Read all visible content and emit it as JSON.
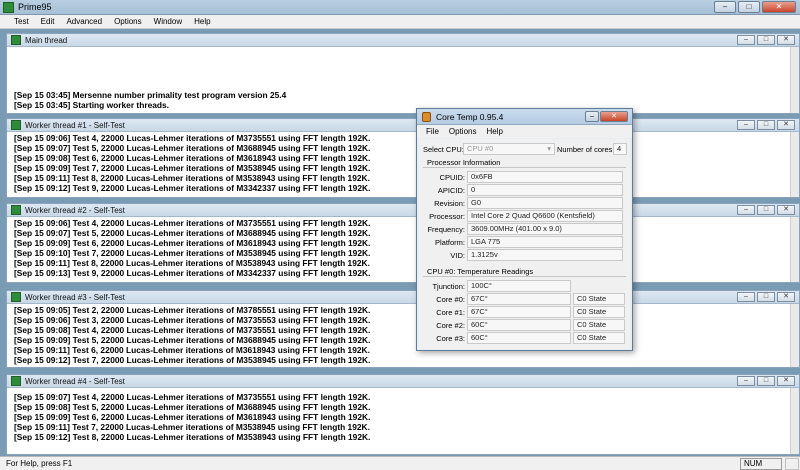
{
  "app": {
    "title": "Prime95"
  },
  "window_buttons": {
    "minimize": "–",
    "maximize": "□",
    "close": "✕"
  },
  "menu": [
    "Test",
    "Edit",
    "Advanced",
    "Options",
    "Window",
    "Help"
  ],
  "main_thread": {
    "title": "Main thread",
    "lines": [
      "[Sep 15 03:45] Mersenne number primality test program version 25.4",
      "[Sep 15 03:45] Starting worker threads."
    ]
  },
  "worker1": {
    "title": "Worker thread #1 - Self-Test",
    "lines": [
      "[Sep 15 09:06] Test 4, 22000 Lucas-Lehmer iterations of M3735551 using FFT length 192K.",
      "[Sep 15 09:07] Test 5, 22000 Lucas-Lehmer iterations of M3688945 using FFT length 192K.",
      "[Sep 15 09:08] Test 6, 22000 Lucas-Lehmer iterations of M3618943 using FFT length 192K.",
      "[Sep 15 09:09] Test 7, 22000 Lucas-Lehmer iterations of M3538945 using FFT length 192K.",
      "[Sep 15 09:11] Test 8, 22000 Lucas-Lehmer iterations of M3538943 using FFT length 192K.",
      "[Sep 15 09:12] Test 9, 22000 Lucas-Lehmer iterations of M3342337 using FFT length 192K."
    ]
  },
  "worker2": {
    "title": "Worker thread #2 - Self-Test",
    "lines": [
      "[Sep 15 09:06] Test 4, 22000 Lucas-Lehmer iterations of M3735551 using FFT length 192K.",
      "[Sep 15 09:07] Test 5, 22000 Lucas-Lehmer iterations of M3688945 using FFT length 192K.",
      "[Sep 15 09:09] Test 6, 22000 Lucas-Lehmer iterations of M3618943 using FFT length 192K.",
      "[Sep 15 09:10] Test 7, 22000 Lucas-Lehmer iterations of M3538945 using FFT length 192K.",
      "[Sep 15 09:11] Test 8, 22000 Lucas-Lehmer iterations of M3538943 using FFT length 192K.",
      "[Sep 15 09:13] Test 9, 22000 Lucas-Lehmer iterations of M3342337 using FFT length 192K."
    ]
  },
  "worker3": {
    "title": "Worker thread #3 - Self-Test",
    "lines": [
      "[Sep 15 09:05] Test 2, 22000 Lucas-Lehmer iterations of M3785551 using FFT length 192K.",
      "[Sep 15 09:06] Test 3, 22000 Lucas-Lehmer iterations of M3735553 using FFT length 192K.",
      "[Sep 15 09:08] Test 4, 22000 Lucas-Lehmer iterations of M3735551 using FFT length 192K.",
      "[Sep 15 09:09] Test 5, 22000 Lucas-Lehmer iterations of M3688945 using FFT length 192K.",
      "[Sep 15 09:11] Test 6, 22000 Lucas-Lehmer iterations of M3618943 using FFT length 192K.",
      "[Sep 15 09:12] Test 7, 22000 Lucas-Lehmer iterations of M3538945 using FFT length 192K."
    ]
  },
  "worker4": {
    "title": "Worker thread #4 - Self-Test",
    "lines": [
      "[Sep 15 09:07] Test 4, 22000 Lucas-Lehmer iterations of M3735551 using FFT length 192K.",
      "[Sep 15 09:08] Test 5, 22000 Lucas-Lehmer iterations of M3688945 using FFT length 192K.",
      "[Sep 15 09:09] Test 6, 22000 Lucas-Lehmer iterations of M3618943 using FFT length 192K.",
      "[Sep 15 09:11] Test 7, 22000 Lucas-Lehmer iterations of M3538945 using FFT length 192K.",
      "[Sep 15 09:12] Test 8, 22000 Lucas-Lehmer iterations of M3538943 using FFT length 192K."
    ]
  },
  "status": {
    "help": "For Help, press F1",
    "num": "NUM"
  },
  "coretemp": {
    "title": "Core Temp 0.95.4",
    "menu": [
      "File",
      "Options",
      "Help"
    ],
    "select_cpu_label": "Select CPU:",
    "select_cpu_value": "CPU #0",
    "cores_label": "Number of cores",
    "cores_value": "4",
    "proc_info_header": "Processor Information",
    "info": [
      {
        "label": "CPUID:",
        "value": "0x6FB"
      },
      {
        "label": "APICID:",
        "value": "0"
      },
      {
        "label": "Revision:",
        "value": "G0"
      },
      {
        "label": "Processor:",
        "value": "Intel Core 2 Quad Q6600 (Kentsfield)"
      },
      {
        "label": "Frequency:",
        "value": "3609.00MHz (401.00 x 9.0)"
      },
      {
        "label": "Platform:",
        "value": "LGA 775"
      },
      {
        "label": "VID:",
        "value": "1.3125v"
      }
    ],
    "temp_header": "CPU #0: Temperature Readings",
    "tjunction_label": "Tjunction:",
    "tjunction_value": "100C°",
    "cores": [
      {
        "label": "Core #0:",
        "temp": "67C°",
        "state": "C0 State"
      },
      {
        "label": "Core #1:",
        "temp": "67C°",
        "state": "C0 State"
      },
      {
        "label": "Core #2:",
        "temp": "60C°",
        "state": "C0 State"
      },
      {
        "label": "Core #3:",
        "temp": "60C°",
        "state": "C0 State"
      }
    ]
  }
}
